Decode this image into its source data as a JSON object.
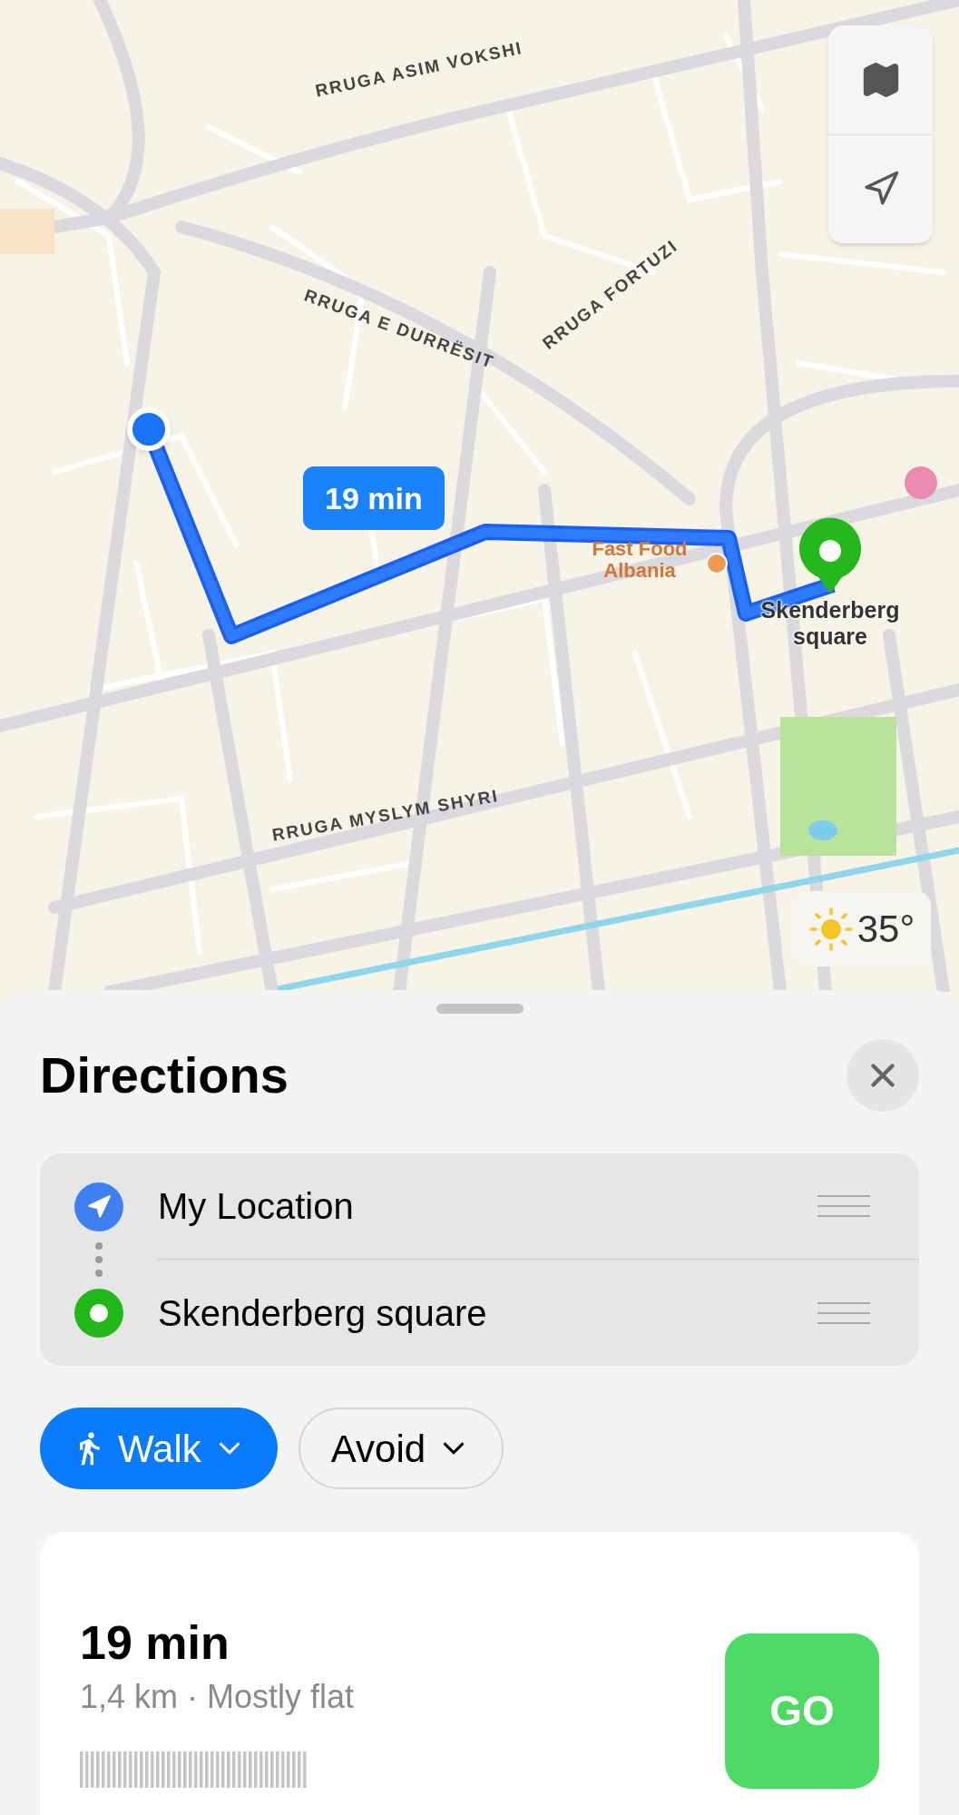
{
  "map": {
    "street_labels": [
      "RRUGA ASIM VOKSHI",
      "RRUGA E DURRËSIT",
      "RRUGA FORTUZI",
      "RRUGA MYSLYM SHYRI"
    ],
    "route_badge": "19 min",
    "poi_label": "Fast Food Albania",
    "destination_label": "Skenderberg square",
    "weather": "35°"
  },
  "sheet": {
    "title": "Directions",
    "stops": [
      {
        "kind": "origin",
        "label": "My Location"
      },
      {
        "kind": "destination",
        "label": "Skenderberg square"
      }
    ],
    "options": [
      {
        "kind": "walk",
        "label": "Walk",
        "selected": true
      },
      {
        "kind": "avoid",
        "label": "Avoid",
        "selected": false
      }
    ],
    "route": {
      "time": "19 min",
      "details": "1,4 km · Mostly flat",
      "action": "GO"
    }
  }
}
